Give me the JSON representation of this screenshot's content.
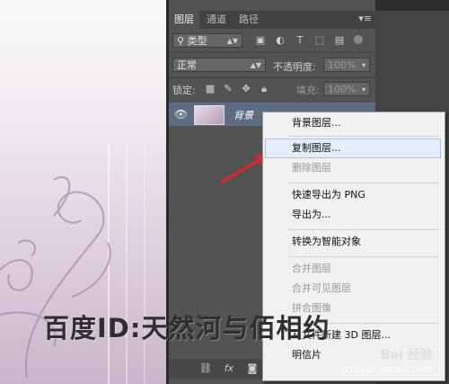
{
  "tabs": [
    "图层",
    "通道",
    "路径"
  ],
  "filter": {
    "kind_label": "类型"
  },
  "blend": {
    "mode": "正常",
    "opacity_label": "不透明度:",
    "opacity_value": "100%"
  },
  "lock": {
    "label": "锁定:",
    "fill_label": "填充:",
    "fill_value": "100%"
  },
  "layer": {
    "name": "背景"
  },
  "context_menu": {
    "items": [
      {
        "label": "背景图层...",
        "enabled": true
      },
      {
        "label": "复制图层...",
        "enabled": true,
        "highlighted": true
      },
      {
        "label": "删除图层",
        "enabled": false
      },
      {
        "label": "快速导出为 PNG",
        "enabled": true
      },
      {
        "label": "导出为...",
        "enabled": true
      },
      {
        "label": "转换为智能对象",
        "enabled": true
      },
      {
        "label": "合并图层",
        "enabled": false
      },
      {
        "label": "合并可见图层",
        "enabled": false
      },
      {
        "label": "拼合图像",
        "enabled": false
      },
      {
        "label": "从文件新建 3D 图层...",
        "enabled": true
      },
      {
        "label": "明信片",
        "enabled": true
      }
    ]
  },
  "watermark": "百度ID:天然河与佰相约",
  "site": "jingyan.baidu.com",
  "baidu_logo": "Bai 经验",
  "colors": {
    "accent_arrow": "#e8222a",
    "selected_layer": "#5d6c82",
    "menu_highlight": "#e5eef8"
  },
  "icons": [
    "eye-icon",
    "link-icon",
    "fx-icon",
    "mask-icon",
    "adjustment-icon",
    "folder-icon",
    "new-layer-icon",
    "trash-icon"
  ]
}
